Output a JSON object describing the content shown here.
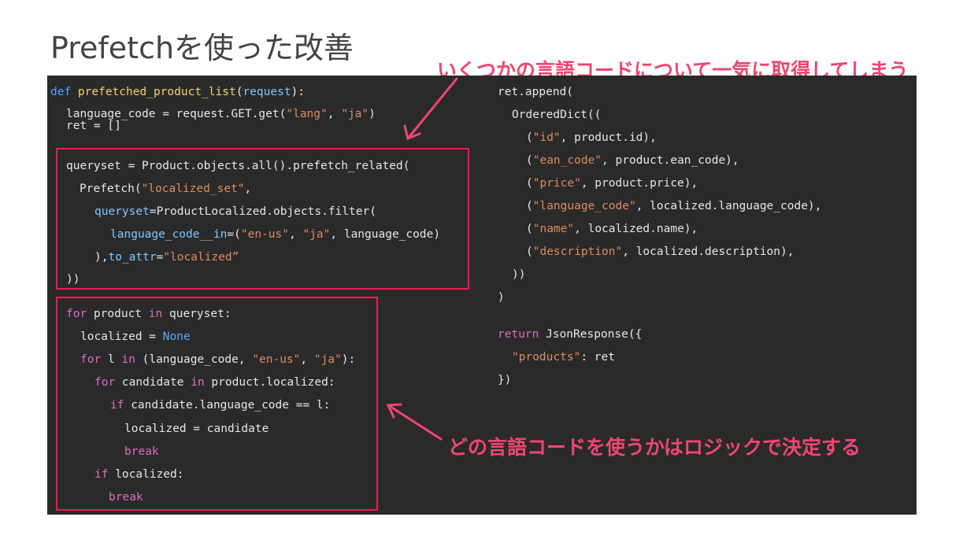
{
  "slide": {
    "title": "Prefetchを使った改善",
    "callout_top": "いくつかの言語コードについて一気に取得してしまう",
    "callout_mid": "どの言語コードを使うかはロジックで決定する"
  },
  "code": {
    "def_kw": "def ",
    "fn_name": "prefetched_product_list",
    "param": "request",
    "def_tail": "):",
    "l_lang": "language_code = request.GET.get(",
    "s_lang": "\"lang\"",
    "comma": ", ",
    "s_ja": "\"ja\"",
    "close": ")",
    "l_ret": "ret = []",
    "l_qs": "queryset = Product.objects.all().prefetch_related(",
    "l_prefetch_a": "Prefetch(",
    "s_localized_set": "\"localized_set\"",
    "l_prefetch_b": ",",
    "kw_queryset": "queryset",
    "l_qs2": "=ProductLocalized.objects.filter(",
    "kw_lang_in": "language_code__in",
    "l_in_a": "=(",
    "s_enus": "\"en-us\"",
    "l_in_b": ", language_code)",
    "l_toattr_a": "),",
    "kw_toattr": "to_attr",
    "l_toattr_b": "=",
    "s_localized": "\"localized”",
    "l_closeall": "))",
    "for_kw": "for",
    "l_for1": " product ",
    "in_kw": "in",
    "l_for1b": " queryset:",
    "l_loc_none": "localized = ",
    "none_kw": "None",
    "l_for2": " l ",
    "l_for2b": " (language_code, ",
    "s_enus2": "\"en-us\"",
    "s_ja2": "\"ja\"",
    "l_for2c": "):",
    "l_for3": " candidate ",
    "l_for3b": " product.localized:",
    "if_kw": "if",
    "l_if1": " candidate.language_code == l:",
    "l_assign": "localized = candidate",
    "break_kw": "break",
    "l_if2": " localized:",
    "r_append": "ret.append(",
    "r_ordered": "OrderedDict((",
    "r_open": "(",
    "s_id": "\"id\"",
    "r_id": ", product.id),",
    "s_ean": "\"ean_code\"",
    "r_ean": ", product.ean_code),",
    "s_price": "\"price\"",
    "r_price": ", product.price),",
    "s_langcode": "\"language_code\"",
    "r_langcode": ", localized.language_code),",
    "s_name": "\"name\"",
    "r_name": ", localized.name),",
    "s_desc": "\"description\"",
    "r_desc": ", localized.description),",
    "r_close2": "))",
    "r_close1": ")",
    "return_kw": "return",
    "r_json": " JsonResponse({",
    "s_products": "\"products\"",
    "r_products": ": ret",
    "r_end": "})"
  },
  "colors": {
    "accent": "#f0466e",
    "box": "#ee1b4e",
    "panel": "#2a2a2a"
  }
}
